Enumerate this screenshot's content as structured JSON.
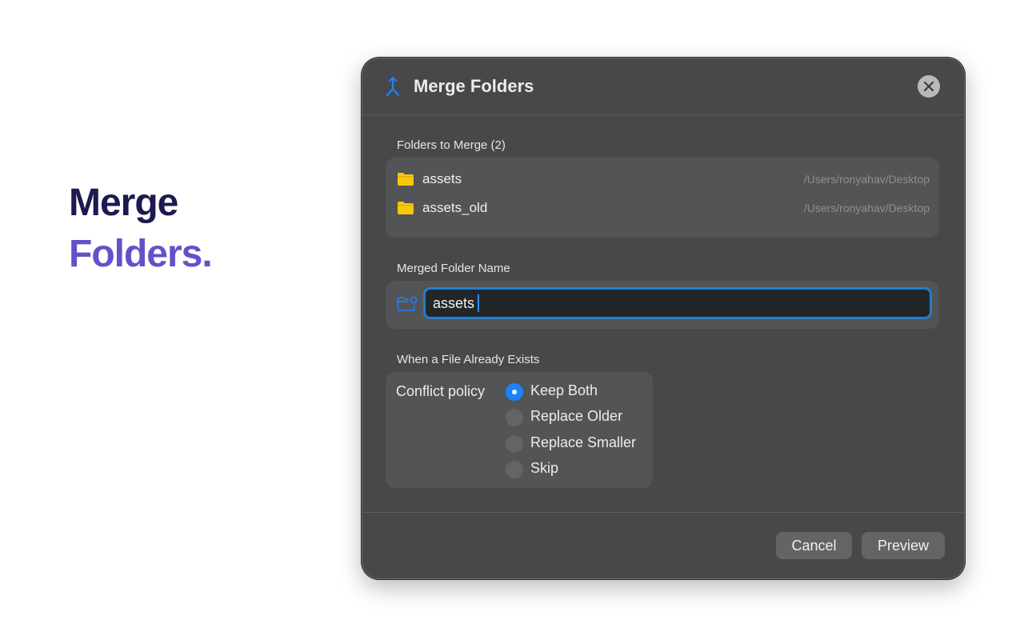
{
  "hero": {
    "line1": "Merge",
    "line2": "Folders."
  },
  "dialog": {
    "title": "Merge Folders",
    "title_icon": "merge-arrow-icon",
    "close_icon": "close-icon",
    "accent": "#1a82ff"
  },
  "folders_section": {
    "label": "Folders to Merge (2)",
    "items": [
      {
        "name": "assets",
        "path": "/Users/ronyahav/Desktop",
        "icon": "folder-icon"
      },
      {
        "name": "assets_old",
        "path": "/Users/ronyahav/Desktop",
        "icon": "folder-icon"
      }
    ]
  },
  "name_section": {
    "label": "Merged Folder Name",
    "icon": "folder-badge-icon",
    "value": "assets"
  },
  "conflict_section": {
    "label": "When a File Already Exists",
    "policy_label": "Conflict policy",
    "options": [
      "Keep Both",
      "Replace Older",
      "Replace Smaller",
      "Skip"
    ],
    "selected": "Keep Both"
  },
  "footer": {
    "cancel_label": "Cancel",
    "preview_label": "Preview"
  }
}
